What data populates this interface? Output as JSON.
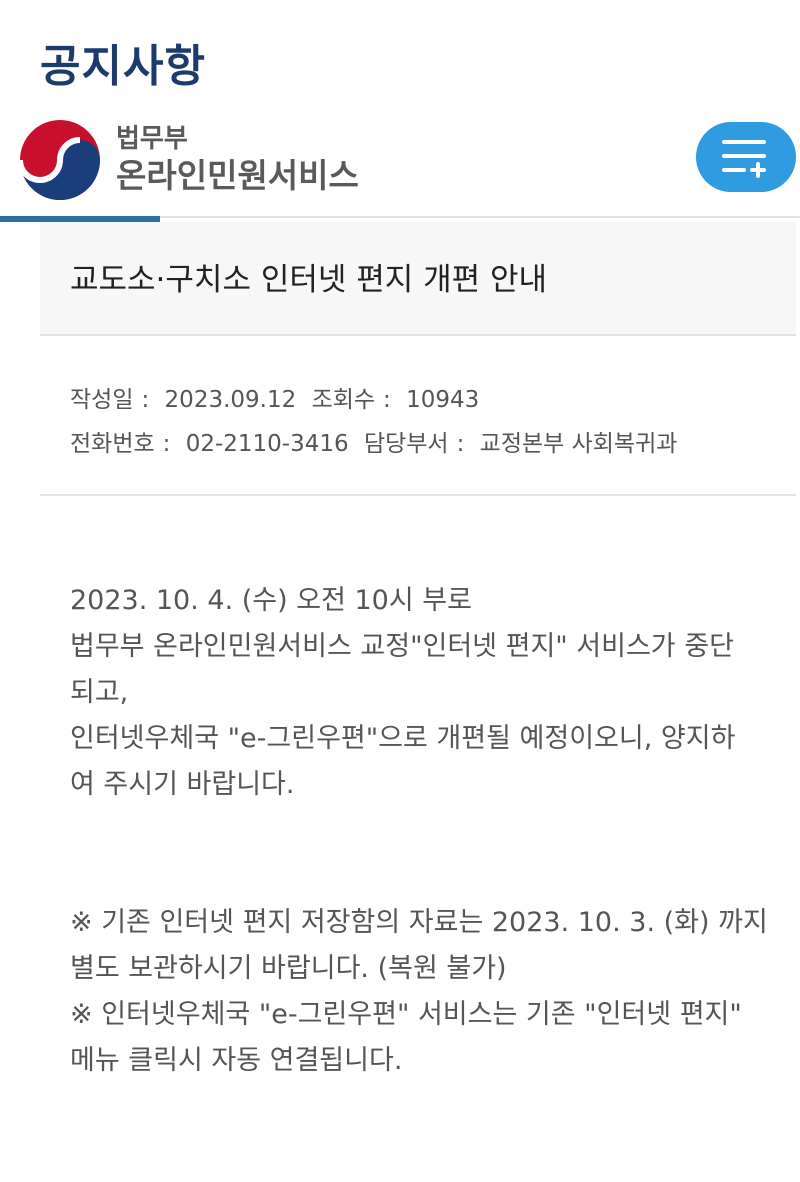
{
  "page": {
    "title": "공지사항"
  },
  "header": {
    "logo_small": "법무부",
    "logo_large": "온라인민원서비스",
    "menu_icon": "menu-plus-icon"
  },
  "notice": {
    "title": "교도소·구치소 인터넷 편지 개편 안내",
    "meta": {
      "date_label": "작성일",
      "date_value": "2023.09.12",
      "views_label": "조회수",
      "views_value": "10943",
      "phone_label": "전화번호",
      "phone_value": "02-2110-3416",
      "dept_label": "담당부서",
      "dept_value": "교정본부 사회복귀과"
    },
    "body": [
      "2023. 10. 4. (수) 오전 10시 부로",
      "법무부 온라인민원서비스 교정\"인터넷 편지\" 서비스가 중단",
      "되고,",
      "인터넷우체국 \"e-그린우편\"으로 개편될 예정이오니, 양지하",
      "여 주시기 바랍니다."
    ],
    "notes": [
      "※ 기존 인터넷 편지 저장함의 자료는 2023. 10. 3. (화) 까지",
      "별도 보관하시기 바랍니다. (복원 불가)",
      "※ 인터넷우체국 \"e-그린우편\" 서비스는 기존 \"인터넷 편지\"",
      "메뉴 클릭시 자동 연결됩니다."
    ]
  }
}
